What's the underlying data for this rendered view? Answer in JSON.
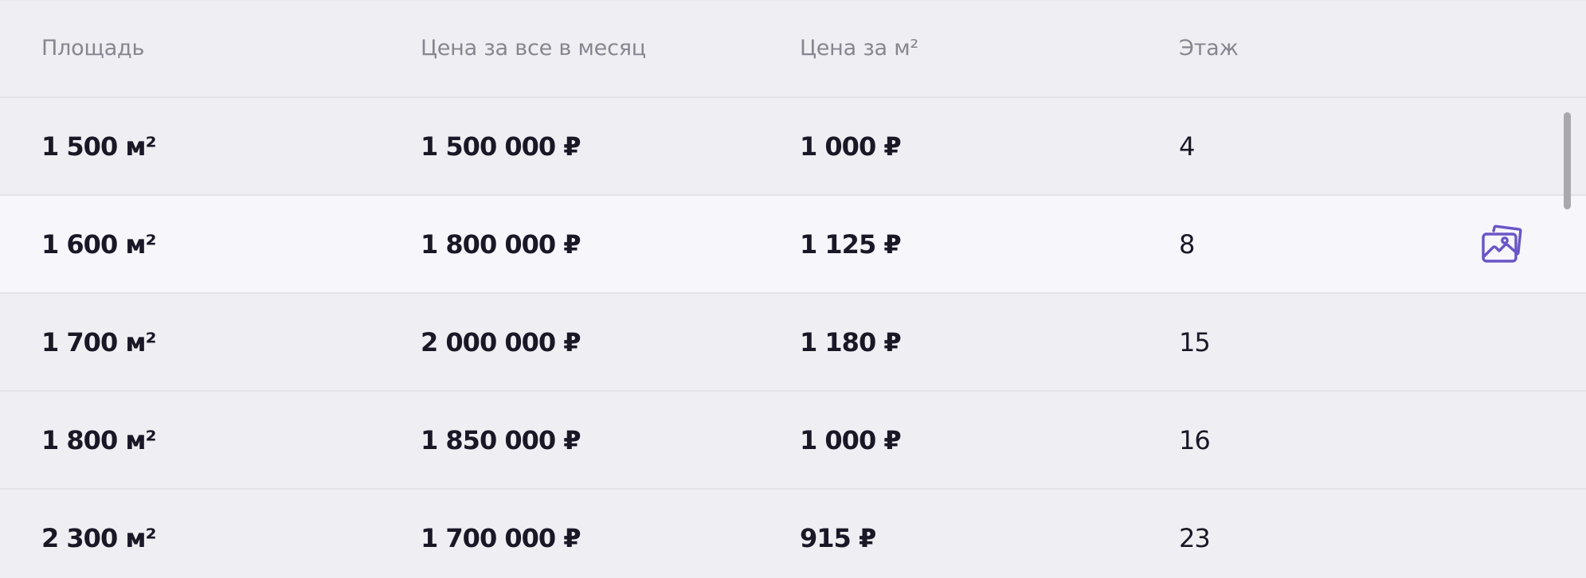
{
  "header": {
    "area": "Площадь",
    "price_month": "Цена за все в месяц",
    "price_m2": "Цена за м²",
    "floor": "Этаж"
  },
  "rows": [
    {
      "area": "1 500 м²",
      "price_month": "1 500 000 ₽",
      "price_m2": "1 000 ₽",
      "floor": "4"
    },
    {
      "area": "1 600 м²",
      "price_month": "1 800 000 ₽",
      "price_m2": "1 125 ₽",
      "floor": "8"
    },
    {
      "area": "1 700 м²",
      "price_month": "2 000 000 ₽",
      "price_m2": "1 180 ₽",
      "floor": "15"
    },
    {
      "area": "1 800 м²",
      "price_month": "1 850 000 ₽",
      "price_m2": "1 000 ₽",
      "floor": "16"
    },
    {
      "area": "2 300 м²",
      "price_month": "1 700 000 ₽",
      "price_m2": "915 ₽",
      "floor": "23"
    }
  ],
  "icons": {
    "photos": "photo-gallery-icon"
  },
  "colors": {
    "background": "#efeef2",
    "highlight_row": "#f7f6fb",
    "header_text": "#87858f",
    "body_text": "#1a1726",
    "accent": "#6a55c7"
  }
}
